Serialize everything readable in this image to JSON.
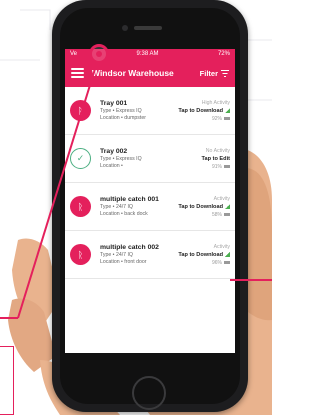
{
  "status_bar": {
    "carrier": "Ve",
    "time": "9:38 AM",
    "battery": "72%"
  },
  "header": {
    "title": "Windsor Warehouse",
    "filter_label": "Filter"
  },
  "items": [
    {
      "name": "Tray 001",
      "type": "Type • Express IQ",
      "location": "Location • dumpster",
      "activity": "High Activity",
      "action": "Tap to Download",
      "battery": "92%",
      "status": "bluetooth"
    },
    {
      "name": "Tray 002",
      "type": "Type • Express IQ",
      "location": "Location •",
      "activity": "No Activity",
      "action": "Tap to Edit",
      "battery": "91%",
      "status": "synced"
    },
    {
      "name": "multiple catch 001",
      "type": "Type • 24/7 IQ",
      "location": "Location • back dock",
      "activity": "Activity",
      "action": "Tap to Download",
      "battery": "58%",
      "status": "bluetooth"
    },
    {
      "name": "multiple catch 002",
      "type": "Type • 24/7 IQ",
      "location": "Location • front door",
      "activity": "Activity",
      "action": "Tap to Download",
      "battery": "96%",
      "status": "bluetooth"
    }
  ],
  "colors": {
    "accent": "#e4205c",
    "ok": "#4caf82"
  },
  "icons": {
    "bluetooth": "bluetooth-icon",
    "synced": "check-circle-icon",
    "menu": "hamburger-menu-icon",
    "filter": "filter-icon"
  }
}
